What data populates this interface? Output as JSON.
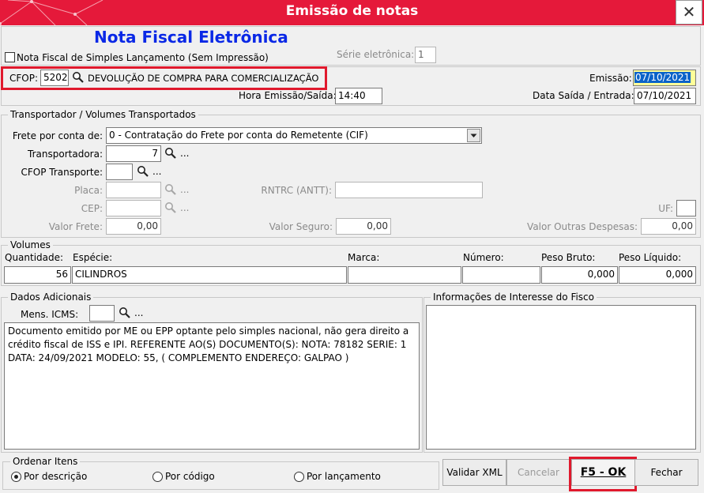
{
  "window": {
    "title": "Emissão de notas",
    "close_glyph": "✕"
  },
  "header": {
    "heading": "Nota Fiscal Eletrônica",
    "simples_checkbox_label": "Nota Fiscal de Simples Lançamento (Sem Impressão)",
    "simples_checked": false,
    "serie_label": "Série eletrônica:",
    "serie_value": "1"
  },
  "cfop": {
    "label": "CFOP:",
    "code": "5202",
    "description": "DEVOLUÇÃO DE COMPRA PARA COMERCIALIZAÇÃO",
    "emissao_label": "Emissão:",
    "emissao_value": "07/10/2021",
    "hora_label": "Hora Emissão/Saída:",
    "hora_value": "14:40",
    "data_saida_label": "Data Saída / Entrada:",
    "data_saida_value": "07/10/2021"
  },
  "transportador": {
    "legend": "Transportador /  Volumes Transportados",
    "frete_label": "Frete por conta de:",
    "frete_value": "0 - Contratação do Frete por conta do Remetente (CIF)",
    "transportadora_label": "Transportadora:",
    "transportadora_value": "7",
    "cfop_transporte_label": "CFOP Transporte:",
    "cfop_transporte_value": "",
    "placa_label": "Placa:",
    "rntrc_label": "RNTRC (ANTT):",
    "cep_label": "CEP:",
    "uf_label": "UF:",
    "valor_frete_label": "Valor Frete:",
    "valor_frete_value": "0,00",
    "valor_seguro_label": "Valor Seguro:",
    "valor_seguro_value": "0,00",
    "outras_label": "Valor Outras Despesas:",
    "outras_value": "0,00",
    "dots": "..."
  },
  "volumes": {
    "legend": "Volumes",
    "headers": {
      "quantidade": "Quantidade:",
      "especie": "Espécie:",
      "marca": "Marca:",
      "numero": "Número:",
      "peso_bruto": "Peso Bruto:",
      "peso_liquido": "Peso Líquido:"
    },
    "values": {
      "quantidade": "56",
      "especie": "CILINDROS",
      "marca": "",
      "numero": "",
      "peso_bruto": "0,000",
      "peso_liquido": "0,000"
    }
  },
  "dados": {
    "legend": "Dados Adicionais",
    "mens_label": "Mens. ICMS:",
    "mens_value": "",
    "text": "Documento emitido por ME ou EPP optante pelo simples nacional, não gera direito a crédito fiscal de ISS e IPI. REFERENTE AO(S) DOCUMENTO(S): NOTA: 78182 SERIE: 1 DATA: 24/09/2021 MODELO: 55, ( COMPLEMENTO ENDEREÇO: GALPAO )"
  },
  "fisco": {
    "legend": "Informações de Interesse do Fisco",
    "text": ""
  },
  "ordenar": {
    "legend": "Ordenar Itens",
    "options": [
      "Por descrição",
      "Por código",
      "Por lançamento"
    ],
    "selected": "Por descrição"
  },
  "buttons": {
    "validar": "Validar XML",
    "cancelar": "Cancelar",
    "ok": "F5 - OK",
    "fechar": "Fechar"
  },
  "colors": {
    "titlebar": "#e5193a",
    "heading": "#0a28e6",
    "highlight": "#e0192d",
    "date_selected": "#0a63c9",
    "date_bg": "#ffff99"
  }
}
